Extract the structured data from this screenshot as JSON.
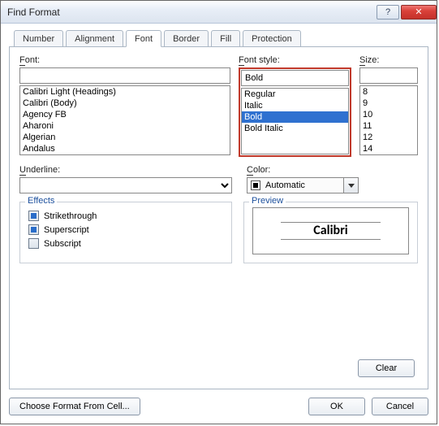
{
  "window": {
    "title": "Find Format"
  },
  "tabs": [
    "Number",
    "Alignment",
    "Font",
    "Border",
    "Fill",
    "Protection"
  ],
  "font": {
    "label_u": "F",
    "label_r": "ont:",
    "value": "",
    "options": [
      "Calibri Light (Headings)",
      "Calibri (Body)",
      "Agency FB",
      "Aharoni",
      "Algerian",
      "Andalus"
    ]
  },
  "fontstyle": {
    "label_u": "F",
    "label_r": "ont style:",
    "value": "Bold",
    "options": [
      "Regular",
      "Italic",
      "Bold",
      "Bold Italic"
    ],
    "selected": "Bold"
  },
  "size": {
    "label_u": "S",
    "label_r": "ize:",
    "value": "",
    "options": [
      "8",
      "9",
      "10",
      "11",
      "12",
      "14"
    ]
  },
  "underline": {
    "label_u": "U",
    "label_r": "nderline:",
    "value": ""
  },
  "color": {
    "label_u": "C",
    "label_r": "olor:",
    "value": "Automatic"
  },
  "effects": {
    "legend": "Effects",
    "items": [
      "Strikethrough",
      "Superscript",
      "Subscript"
    ]
  },
  "preview": {
    "legend": "Preview",
    "text": "Calibri"
  },
  "buttons": {
    "clear": "Clear",
    "choose": "Choose Format From Cell...",
    "ok": "OK",
    "cancel": "Cancel"
  }
}
